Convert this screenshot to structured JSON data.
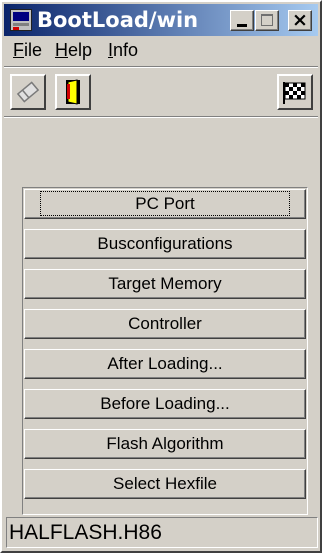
{
  "window": {
    "title": "BootLoad/win",
    "close_glyph": "×"
  },
  "menu": {
    "file": {
      "mnemonic": "F",
      "rest": "ile"
    },
    "help": {
      "mnemonic": "H",
      "rest": "elp"
    },
    "info": {
      "mnemonic": "I",
      "rest": "nfo"
    }
  },
  "toolbar": {
    "icons": [
      "eraser-icon",
      "exit-door-icon",
      "checkered-flag-icon"
    ]
  },
  "buttons": [
    "PC Port",
    "Busconfigurations",
    "Target Memory",
    "Controller",
    "After Loading...",
    "Before Loading...",
    "Flash Algorithm",
    "Select Hexfile"
  ],
  "status": {
    "file": "HALFLASH.H86"
  },
  "colors": {
    "titlebar_start": "#0a246a",
    "titlebar_end": "#a6caf0",
    "face": "#d4d0c8"
  }
}
